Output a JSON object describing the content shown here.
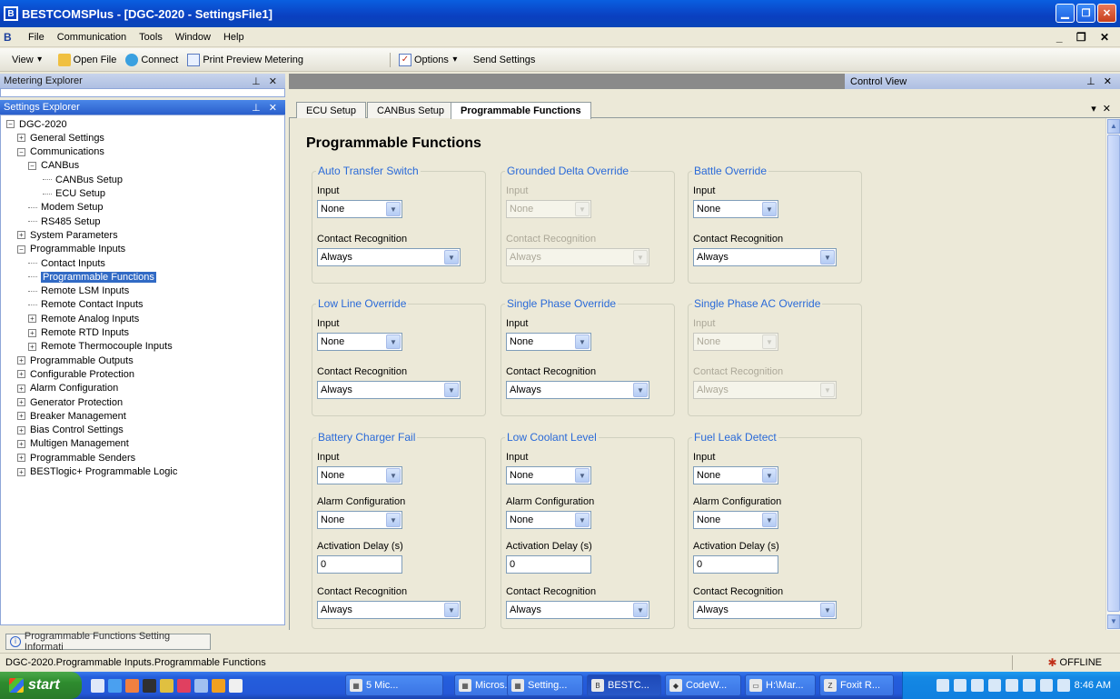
{
  "window": {
    "title": "BESTCOMSPlus - [DGC-2020 - SettingsFile1]",
    "app_icon": "bestcoms-icon"
  },
  "menu": [
    "File",
    "Communication",
    "Tools",
    "Window",
    "Help"
  ],
  "toolbar": {
    "view": "View",
    "open_file": "Open File",
    "connect": "Connect",
    "print_preview": "Print Preview Metering",
    "options": "Options",
    "send_settings": "Send Settings"
  },
  "panels": {
    "metering_explorer": "Metering Explorer",
    "settings_explorer": "Settings Explorer",
    "control_view": "Control View"
  },
  "tree": [
    {
      "label": "DGC-2020",
      "level": 0,
      "exp": "−"
    },
    {
      "label": "General Settings",
      "level": 1,
      "exp": "+"
    },
    {
      "label": "Communications",
      "level": 1,
      "exp": "−"
    },
    {
      "label": "CANBus",
      "level": 2,
      "exp": "−"
    },
    {
      "label": "CANBus Setup",
      "level": 3,
      "exp": ""
    },
    {
      "label": "ECU Setup",
      "level": 3,
      "exp": ""
    },
    {
      "label": "Modem Setup",
      "level": 2,
      "exp": ""
    },
    {
      "label": "RS485 Setup",
      "level": 2,
      "exp": ""
    },
    {
      "label": "System Parameters",
      "level": 1,
      "exp": "+"
    },
    {
      "label": "Programmable Inputs",
      "level": 1,
      "exp": "−"
    },
    {
      "label": "Contact Inputs",
      "level": 2,
      "exp": ""
    },
    {
      "label": "Programmable Functions",
      "level": 2,
      "exp": "",
      "selected": true
    },
    {
      "label": "Remote LSM Inputs",
      "level": 2,
      "exp": ""
    },
    {
      "label": "Remote Contact Inputs",
      "level": 2,
      "exp": ""
    },
    {
      "label": "Remote Analog Inputs",
      "level": 2,
      "exp": "+"
    },
    {
      "label": "Remote RTD Inputs",
      "level": 2,
      "exp": "+"
    },
    {
      "label": "Remote Thermocouple Inputs",
      "level": 2,
      "exp": "+"
    },
    {
      "label": "Programmable Outputs",
      "level": 1,
      "exp": "+"
    },
    {
      "label": "Configurable Protection",
      "level": 1,
      "exp": "+"
    },
    {
      "label": "Alarm Configuration",
      "level": 1,
      "exp": "+"
    },
    {
      "label": "Generator Protection",
      "level": 1,
      "exp": "+"
    },
    {
      "label": "Breaker Management",
      "level": 1,
      "exp": "+"
    },
    {
      "label": "Bias Control Settings",
      "level": 1,
      "exp": "+"
    },
    {
      "label": "Multigen Management",
      "level": 1,
      "exp": "+"
    },
    {
      "label": "Programmable Senders",
      "level": 1,
      "exp": "+"
    },
    {
      "label": "BESTlogic+ Programmable Logic",
      "level": 1,
      "exp": "+"
    }
  ],
  "tabs": [
    {
      "label": "ECU Setup",
      "active": false
    },
    {
      "label": "CANBus Setup",
      "active": false
    },
    {
      "label": "Programmable Functions",
      "active": true
    }
  ],
  "page_title": "Programmable Functions",
  "labels": {
    "input": "Input",
    "contact_recognition": "Contact Recognition",
    "alarm_configuration": "Alarm Configuration",
    "activation_delay": "Activation Delay (s)"
  },
  "groups": [
    {
      "title": "Auto Transfer Switch",
      "input": "None",
      "contact": "Always",
      "disabled": false
    },
    {
      "title": "Grounded Delta Override",
      "input": "None",
      "contact": "Always",
      "disabled": true
    },
    {
      "title": "Battle Override",
      "input": "None",
      "contact": "Always",
      "disabled": false
    },
    {
      "title": "Low Line Override",
      "input": "None",
      "contact": "Always",
      "disabled": false
    },
    {
      "title": "Single Phase Override",
      "input": "None",
      "contact": "Always",
      "disabled": false
    },
    {
      "title": "Single Phase AC Override",
      "input": "None",
      "contact": "Always",
      "disabled": true
    },
    {
      "title": "Battery Charger Fail",
      "input": "None",
      "alarm": "None",
      "delay": "0",
      "contact": "Always",
      "disabled": false
    },
    {
      "title": "Low Coolant Level",
      "input": "None",
      "alarm": "None",
      "delay": "0",
      "contact": "Always",
      "disabled": false
    },
    {
      "title": "Fuel Leak Detect",
      "input": "None",
      "alarm": "None",
      "delay": "0",
      "contact": "Always",
      "disabled": false
    }
  ],
  "info_tab": "Programmable Functions Setting Informati",
  "status": {
    "path": "DGC-2020.Programmable Inputs.Programmable Functions",
    "connection": "OFFLINE"
  },
  "taskbar": {
    "start": "start",
    "tasks": [
      "5 Mic...",
      "Micros...",
      "Setting...",
      "BESTC...",
      "CodeW...",
      "H:\\Mar...",
      "Foxit R..."
    ],
    "clock": "8:46 AM"
  }
}
